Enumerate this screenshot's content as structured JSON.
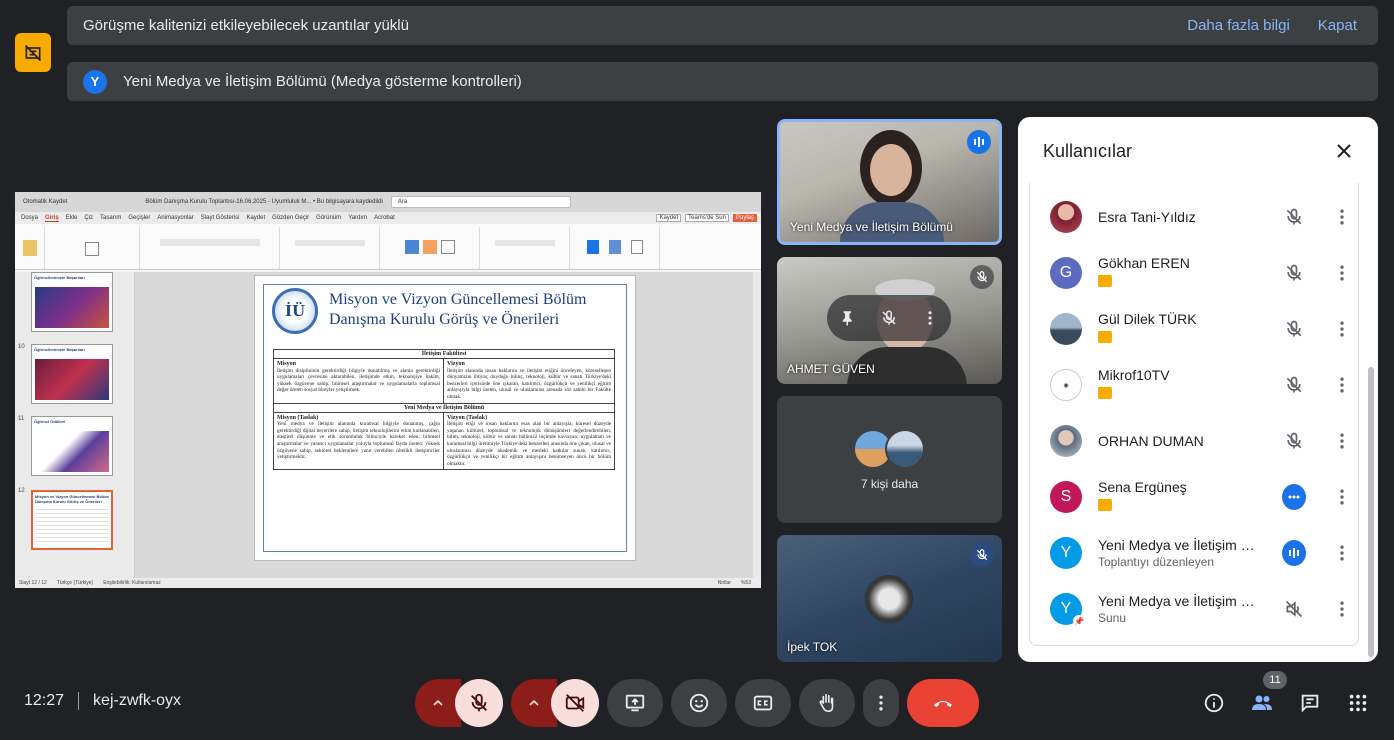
{
  "banners": {
    "extensions_text": "Görüşme kalitenizi etkileyebilecek uzantılar yüklü",
    "learn_more": "Daha fazla bilgi",
    "dismiss": "Kapat",
    "presenter_initial": "Y",
    "presenter_text": "Yeni Medya ve İletişim Bölümü (Medya gösterme kontrolleri)"
  },
  "presentation": {
    "window_title": "Bölüm Danışma Kurulu Toplantısı-16.06.2025 - Uyumluluk M... • Bu bilgisayara kaydedildi",
    "autosave": "Otomatik Kaydet",
    "search_placeholder": "Ara",
    "tabs": [
      "Dosya",
      "Giriş",
      "Ekle",
      "Çiz",
      "Tasarım",
      "Geçişler",
      "Animasyonlar",
      "Slayt Gösterisi",
      "Kaydet",
      "Gözden Geçir",
      "Görünüm",
      "Yardım",
      "Acrobat"
    ],
    "active_tab": "Giriş",
    "right_buttons": [
      "Kaydet",
      "Teams'de Sun",
      "Paylaş"
    ],
    "thumb_numbers": [
      "10",
      "11",
      "12"
    ],
    "thumb_titles": [
      "Öğrencilerimizin Başarıları",
      "Öğrencilerimizin Başarıları",
      "Öğrenci Ödülleri",
      "Misyon ve Vizyon Güncellemesi Bölüm Danışma Kurulu Görüş ve Önerileri"
    ],
    "slide": {
      "logo": "İÜ",
      "title": "Misyon ve Vizyon Güncellemesi Bölüm Danışma Kurulu Görüş ve Önerileri",
      "faculty_header": "İletişim Fakültesi",
      "mission_label": "Misyon",
      "vision_label": "Vizyon",
      "mission_text": "İletişim disiplininin gerektirdiği bilgiyle donatılmış ve alanın gerektirdiği uygulamaları çevresine aktarabilen, iletişimde etkin, teknolojiye hakim, yüksek özgüvene sahip, bilimsel araştırmalar ve uygulamalarla toplumsal değer üreten sosyal bireyler yetiştirmek.",
      "vision_text": "İletişim alanında insan haklarını ve iletişim etiğini önceleyen, küreselleşen dünyamızın ihtiyaç duyduğu bilinç, teknoloji, kültür ve sanatı Türkiye'deki benzerleri içerisinde öne çıkaran, katılımcı, özgürlükçü ve yenilikçi eğitim anlayışıyla bilgi üreten, ulusal ve uluslararası arenada söz sahibi bir Fakülte olmak.",
      "dept_header": "Yeni Medya ve İletişim Bölümü",
      "mission_draft_label": "Misyon (Taslak)",
      "vision_draft_label": "Vizyon (Taslak)",
      "mission_draft_text": "Yeni medya ve iletişim alanında kuramsal bilgiyle donanmış, çağın gerektirdiği dijital becerilere sahip, iletişim teknolojilerini etkin kullanabilen, eleştirel düşünme ve etik sorumluluk bilinciyle hareket eden, bilimsel araştırmalar ve yaratıcı uygulamalar yoluyla toplumsal fayda üreten; yüksek özgüvene sahip, sektörel beklentilere yanıt verebilen nitelikli iletişimciler yetiştirmektir.",
      "vision_draft_text": "İletişim etiği ve insan haklarını esas alan bir anlayışla; küresel düzeyde yaşanan kültürel, toplumsal ve teknolojik dönüşümleri değerlendirebilen, bilim, teknoloji, kültür ve sanatı bütüncül biçimde kavrayan; uygulamalı ve kuramsal bilgi üretimiyle Türkiye'deki benzerleri arasında öne çıkan, ulusal ve uluslararası düzeyde akademik ve mesleki katkılar sunan, katılımcı, özgürlükçü ve yenilikçi bir eğitim anlayışını benimseyen öncü bir bölüm olmaktır."
    },
    "status": {
      "slide_of": "Slayt 12 / 12",
      "language": "Türkçe (Türkiye)",
      "accessibility": "Erişilebilirlik: Kullanılamaz",
      "notes": "Notlar",
      "zoom": "%53"
    }
  },
  "tiles": [
    {
      "name": "Yeni Medya ve İletişim Bölümü"
    },
    {
      "name": "AHMET GÜVEN"
    },
    {
      "name": "7 kişi daha"
    },
    {
      "name": "İpek TOK"
    }
  ],
  "panel": {
    "title": "Kullanıcılar",
    "participants": [
      {
        "name": "Esra Tani-Yıldız",
        "sub": "",
        "initial": "",
        "color": "#b84a5a",
        "status": "muted"
      },
      {
        "name": "Gökhan EREN",
        "sub": "",
        "initial": "G",
        "color": "#5c6bc0",
        "status": "muted"
      },
      {
        "name": "Gül Dilek TÜRK",
        "sub": "",
        "initial": "",
        "color": "#4a5a6a",
        "status": "muted"
      },
      {
        "name": "Mikrof10TV",
        "sub": "",
        "initial": "",
        "color": "#ffffff",
        "status": "muted"
      },
      {
        "name": "ORHAN DUMAN",
        "sub": "",
        "initial": "",
        "color": "#7a8a9a",
        "status": "muted"
      },
      {
        "name": "Sena Ergüneş",
        "sub": "",
        "initial": "S",
        "color": "#c2185b",
        "status": "more"
      },
      {
        "name": "Yeni Medya ve İletişim Bölümü",
        "sub": "Toplantıyı düzenleyen",
        "initial": "Y",
        "color": "#039be5",
        "status": "speaking"
      },
      {
        "name": "Yeni Medya ve İletişim Bölümü",
        "sub": "Sunu",
        "initial": "Y",
        "color": "#039be5",
        "status": "audio-off"
      }
    ]
  },
  "meeting": {
    "time": "12:27",
    "code": "kej-zwfk-oyx",
    "participant_count": "11"
  },
  "colors": {
    "accent": "#8ab4f8",
    "end_call": "#ea4335",
    "muted_bg": "#f9dedc",
    "extension_warning": "#f9ab00"
  }
}
